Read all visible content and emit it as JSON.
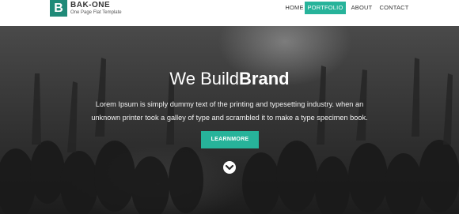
{
  "brand": {
    "mark": "B",
    "title": "BAK-ONE",
    "subtitle": "One Page Flat Template"
  },
  "nav": {
    "items": [
      {
        "label": "HOME",
        "active": false
      },
      {
        "label": "PORTFOLIO",
        "active": true
      },
      {
        "label": "ABOUT",
        "active": false
      },
      {
        "label": "CONTACT",
        "active": false
      }
    ]
  },
  "hero": {
    "headline_thin": "We Build",
    "headline_bold": "Brand",
    "lead": "Lorem Ipsum is simply dummy text of the printing and typesetting industry. when an unknown printer took a galley of type and scrambled it to make a type specimen book.",
    "cta_label": "LEARNMORE",
    "scroll_icon": "chevron-down-circle-icon"
  },
  "colors": {
    "accent": "#27b39a",
    "brand_mark": "#1f8a78",
    "header_bg": "#ffffff",
    "hero_dark": "#2b2b2b"
  }
}
